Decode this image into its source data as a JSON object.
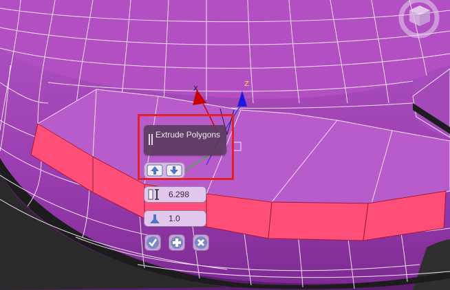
{
  "caddy": {
    "title": "Extrude Polygons",
    "height_value": "6.298",
    "outline_value": "1.0"
  },
  "axes": {
    "x_label": "X",
    "z_label": "Z"
  },
  "icons": {
    "grip": "grip-icon",
    "mode": "extrude-mode-icon",
    "height": "height-icon",
    "outline": "outline-icon",
    "ok": "checkmark-icon",
    "apply": "plus-icon",
    "cancel": "close-icon",
    "viewcube": "viewcube-icon"
  },
  "colors": {
    "mesh": "#b455c6",
    "extruded_faces": "#ff4e78",
    "highlight": "#e0202a"
  }
}
